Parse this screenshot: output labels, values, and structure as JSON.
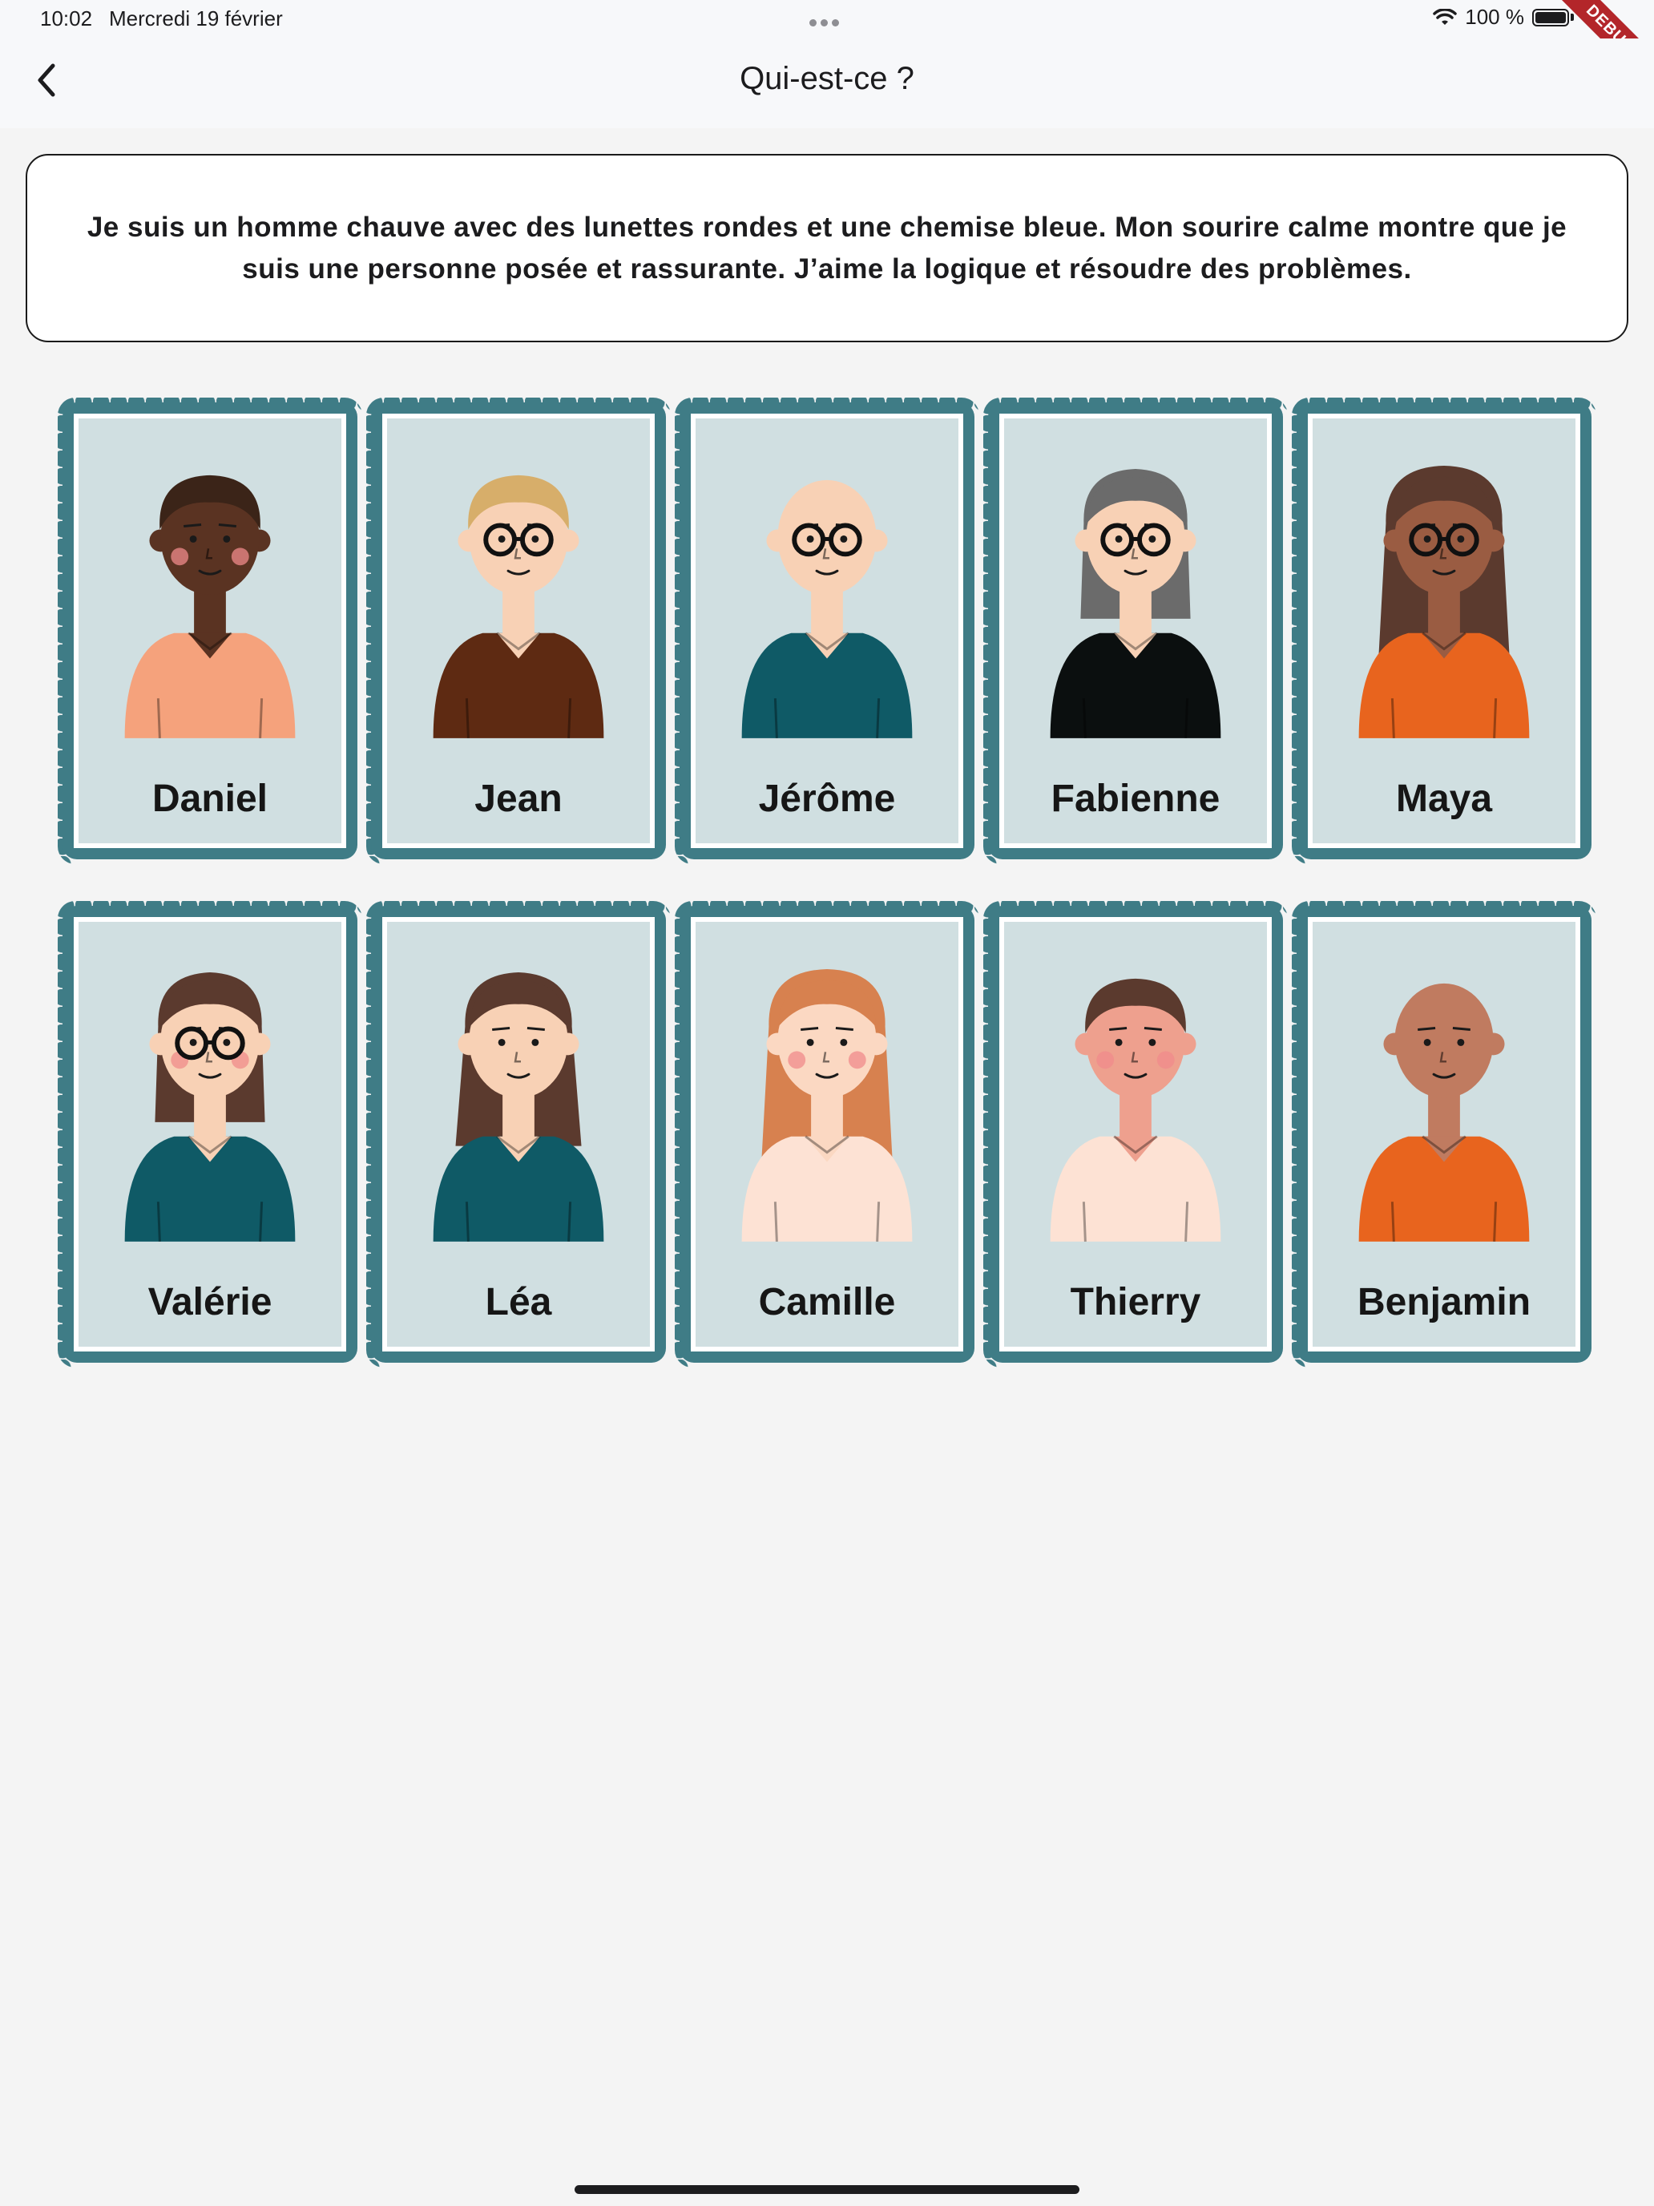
{
  "status_bar": {
    "time": "10:02",
    "date": "Mercredi 19 février",
    "battery": "100 %",
    "debug_banner": "DEBUG"
  },
  "nav": {
    "title": "Qui-est-ce ?",
    "back_icon": "chevron-left-icon"
  },
  "clue": {
    "text": "Je suis un homme chauve avec des lunettes rondes et une chemise bleue. Mon sourire calme montre que je suis une personne posée et rassurante. J’aime la logique et résoudre des problèmes."
  },
  "colors": {
    "card_frame": "#3f7c86",
    "card_bg": "#d0dfe1",
    "background": "#f4f4f4"
  },
  "characters": [
    {
      "name": "Daniel",
      "skin": "#5a3322",
      "hair": "#3b2418",
      "hair_style": "short",
      "shirt": "#f5a27c",
      "glasses": false,
      "blush": true
    },
    {
      "name": "Jean",
      "skin": "#f8d1b5",
      "hair": "#d7ae6a",
      "hair_style": "short",
      "shirt": "#5e2a12",
      "glasses": true,
      "blush": false
    },
    {
      "name": "Jérôme",
      "skin": "#f8d1b5",
      "hair": "none",
      "hair_style": "bald",
      "shirt": "#0f5a66",
      "glasses": true,
      "blush": false
    },
    {
      "name": "Fabienne",
      "skin": "#f8d1b5",
      "hair": "#6b6b6b",
      "hair_style": "bob",
      "shirt": "#0b0f0f",
      "glasses": true,
      "blush": false
    },
    {
      "name": "Maya",
      "skin": "#9a5c42",
      "hair": "#5b3a2e",
      "hair_style": "long",
      "shirt": "#e8641e",
      "glasses": true,
      "blush": false
    },
    {
      "name": "Valérie",
      "skin": "#f8d1b5",
      "hair": "#5b3a2e",
      "hair_style": "bob",
      "shirt": "#0f5a66",
      "glasses": true,
      "blush": true
    },
    {
      "name": "Léa",
      "skin": "#f8d1b5",
      "hair": "#5b3a2e",
      "hair_style": "medium",
      "shirt": "#0f5a66",
      "glasses": false,
      "blush": false
    },
    {
      "name": "Camille",
      "skin": "#fbd8c2",
      "hair": "#d7814f",
      "hair_style": "long",
      "shirt": "#fde2d4",
      "glasses": false,
      "blush": true
    },
    {
      "name": "Thierry",
      "skin": "#eea08e",
      "hair": "#5b3a2e",
      "hair_style": "short",
      "shirt": "#fde2d4",
      "glasses": false,
      "blush": true
    },
    {
      "name": "Benjamin",
      "skin": "#c07b60",
      "hair": "none",
      "hair_style": "bald",
      "shirt": "#e8641e",
      "glasses": false,
      "blush": false
    }
  ]
}
